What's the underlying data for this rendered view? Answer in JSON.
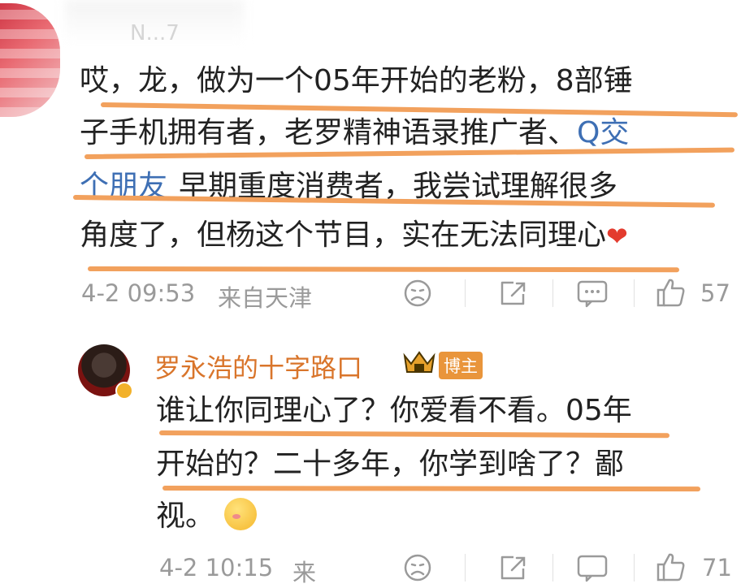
{
  "top": {
    "cropped_name": "N...7"
  },
  "comment": {
    "lines": [
      "哎，龙，做为一个05年开始的老粉，8部锤",
      "子手机拥有者，老罗精神语录推广者、",
      "早期重度消费者，我尝试理解很多",
      "角度了，但杨这个节目，实在无法同理心"
    ],
    "search_prefix": "Q",
    "link_part1": "交",
    "link_part2": "个朋友",
    "time": "4-2 09:53",
    "source": "来自天津",
    "likes": "57"
  },
  "reply": {
    "author": "罗永浩的十字路口",
    "badge": "博主",
    "lines": [
      "谁让你同理心了？你爱看不看。05年",
      "开始的？二十多年，你学到啥了？鄙",
      "视。"
    ],
    "time": "4-2 10:15",
    "source": "来",
    "likes": "71"
  },
  "icons": {
    "dislike": "frown-face-icon",
    "share": "share-icon",
    "comment": "comment-icon",
    "like": "thumbs-up-icon",
    "heart": "heart-icon",
    "crown": "crown-icon",
    "emoji": "shy-emoji-icon"
  },
  "colors": {
    "underline": "#f2a15d",
    "link": "#3e6fb4",
    "author": "#d9752b",
    "badge": "#e9953b",
    "meta": "#9a9a9a"
  }
}
